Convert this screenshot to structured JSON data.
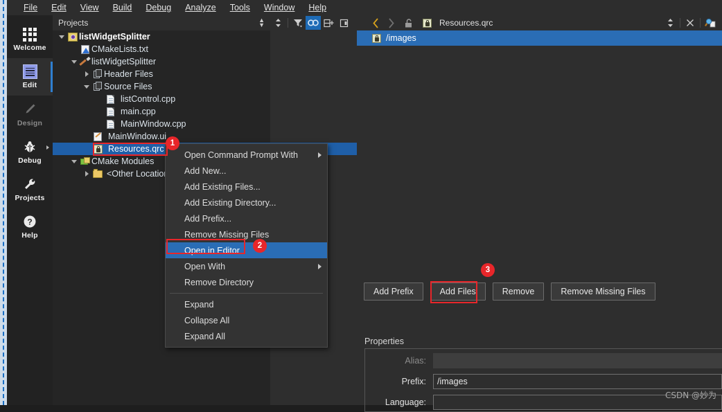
{
  "menubar": {
    "items": [
      {
        "label": "File",
        "accel": "F"
      },
      {
        "label": "Edit",
        "accel": "E"
      },
      {
        "label": "View",
        "accel": "V"
      },
      {
        "label": "Build",
        "accel": "B"
      },
      {
        "label": "Debug",
        "accel": "D"
      },
      {
        "label": "Analyze",
        "accel": "A"
      },
      {
        "label": "Tools",
        "accel": "T"
      },
      {
        "label": "Window",
        "accel": "W"
      },
      {
        "label": "Help",
        "accel": "H"
      }
    ]
  },
  "activity_bar": {
    "items": [
      {
        "label": "Welcome",
        "icon": "grid-icon",
        "state": "normal"
      },
      {
        "label": "Edit",
        "icon": "document-lines-icon",
        "state": "selected"
      },
      {
        "label": "Design",
        "icon": "pencil-icon",
        "state": "disabled"
      },
      {
        "label": "Debug",
        "icon": "bug-icon",
        "state": "normal",
        "has_submenu": true
      },
      {
        "label": "Projects",
        "icon": "wrench-icon",
        "state": "normal"
      },
      {
        "label": "Help",
        "icon": "question-mark-icon",
        "state": "normal"
      }
    ]
  },
  "projects_panel": {
    "title": "Projects",
    "tree": [
      {
        "label": "listWidgetSplitter",
        "icon": "qt-project-icon",
        "indent": 0,
        "twisty": "down",
        "bold": true
      },
      {
        "label": "CMakeLists.txt",
        "icon": "cmake-file-icon",
        "indent": 1,
        "twisty": "none",
        "bold": false
      },
      {
        "label": "listWidgetSplitter",
        "icon": "build-target-icon",
        "indent": 1,
        "twisty": "down",
        "bold": false
      },
      {
        "label": "Header Files",
        "icon": "files-icon",
        "indent": 2,
        "twisty": "right",
        "bold": false
      },
      {
        "label": "Source Files",
        "icon": "files-icon",
        "indent": 2,
        "twisty": "down",
        "bold": false
      },
      {
        "label": "listControl.cpp",
        "icon": "cpp-file-icon",
        "indent": 3,
        "twisty": "none",
        "bold": false
      },
      {
        "label": "main.cpp",
        "icon": "cpp-file-icon",
        "indent": 3,
        "twisty": "none",
        "bold": false
      },
      {
        "label": "MainWindow.cpp",
        "icon": "cpp-file-icon",
        "indent": 3,
        "twisty": "none",
        "bold": false
      },
      {
        "label": "MainWindow.ui",
        "icon": "ui-file-icon",
        "indent": 2,
        "twisty": "none",
        "bold": false
      },
      {
        "label": "Resources.qrc",
        "icon": "qrc-file-icon",
        "indent": 2,
        "twisty": "none",
        "bold": false,
        "selected": true
      },
      {
        "label": "CMake Modules",
        "icon": "cmake-modules-icon",
        "indent": 1,
        "twisty": "down",
        "bold": false
      },
      {
        "label": "<Other Locations>",
        "icon": "folder-icon",
        "indent": 2,
        "twisty": "right",
        "bold": false
      }
    ]
  },
  "editor_toolbar": {
    "buttons": [
      {
        "name": "split-selector",
        "icon": "updown-arrows-icon"
      },
      {
        "name": "filter",
        "icon": "filter-icon"
      },
      {
        "name": "synchronize-selection",
        "icon": "link-icon",
        "active": true
      },
      {
        "name": "split",
        "icon": "split-plus-icon"
      },
      {
        "name": "close-split",
        "icon": "close-split-icon"
      },
      {
        "name": "go-back",
        "icon": "chevron-left-icon",
        "active": true
      },
      {
        "name": "go-forward",
        "icon": "chevron-right-icon"
      },
      {
        "name": "lock-document",
        "icon": "unlocked-padlock-icon"
      }
    ],
    "open_document": "Resources.qrc",
    "open_document_icon": "qrc-file-icon",
    "right_buttons": [
      {
        "name": "document-dropdown",
        "icon": "updown-arrows-icon"
      },
      {
        "name": "close-document",
        "icon": "close-x-icon"
      },
      {
        "name": "search-results",
        "icon": "magnifier-copy-icon"
      }
    ]
  },
  "context_menu": {
    "items": [
      {
        "label": "Open Command Prompt With",
        "submenu": true
      },
      {
        "label": "Add New...",
        "submenu": false
      },
      {
        "label": "Add Existing Files...",
        "submenu": false
      },
      {
        "label": "Add Existing Directory...",
        "submenu": false
      },
      {
        "label": "Add Prefix...",
        "submenu": false
      },
      {
        "label": "Remove Missing Files",
        "submenu": false
      },
      {
        "label": "Open in Editor",
        "submenu": false,
        "highlighted": true
      },
      {
        "label": "Open With",
        "submenu": true
      },
      {
        "label": "Remove Directory",
        "submenu": false
      },
      {
        "separator_after": true
      },
      {
        "label": "Expand",
        "submenu": false
      },
      {
        "label": "Collapse All",
        "submenu": false
      },
      {
        "label": "Expand All",
        "submenu": false
      }
    ]
  },
  "resource_editor": {
    "tree": [
      {
        "label": "/images",
        "icon": "qrc-prefix-icon",
        "selected": true
      }
    ],
    "buttons": [
      {
        "label": "Add Prefix"
      },
      {
        "label": "Add Files"
      },
      {
        "label": "Remove"
      },
      {
        "label": "Remove Missing Files"
      }
    ],
    "properties": {
      "title": "Properties",
      "rows": [
        {
          "label": "Alias:",
          "value": "",
          "enabled": false
        },
        {
          "label": "Prefix:",
          "value": "/images",
          "enabled": true
        },
        {
          "label": "Language:",
          "value": "",
          "enabled": true
        }
      ]
    }
  },
  "annotations": {
    "badges": [
      {
        "number": "1",
        "target": "Resources.qrc tree item"
      },
      {
        "number": "2",
        "target": "Open in Editor menu item"
      },
      {
        "number": "3",
        "target": "Add Files button"
      }
    ]
  },
  "watermark": {
    "text": "CSDN @妙为"
  },
  "colors": {
    "accent_blue": "#2a6db5",
    "selection_blue": "#1f5fa8",
    "annotation_red": "#e8262a",
    "panel_bg": "#2e2e2e",
    "tree_bg": "#252525",
    "toolbar_bg": "#2d2d2d"
  }
}
